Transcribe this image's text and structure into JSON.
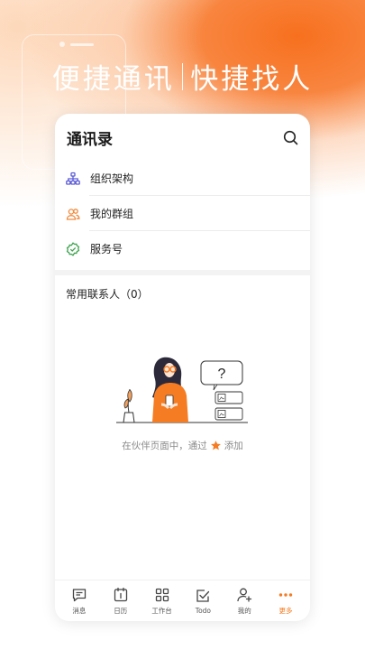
{
  "banner": {
    "left_text": "便捷通讯",
    "right_text": "快捷找人"
  },
  "contacts": {
    "title": "通讯录",
    "menu": [
      {
        "label": "组织架构",
        "icon": "org-chart-icon"
      },
      {
        "label": "我的群组",
        "icon": "group-icon"
      },
      {
        "label": "服务号",
        "icon": "verified-badge-icon"
      }
    ],
    "frequent_title": "常用联系人（0）",
    "empty_hint_before": "在伙伴页面中，通过",
    "empty_hint_after": "添加"
  },
  "tabs": [
    {
      "label": "消息",
      "icon": "message-icon",
      "active": false
    },
    {
      "label": "日历",
      "icon": "calendar-icon",
      "active": false
    },
    {
      "label": "工作台",
      "icon": "workbench-icon",
      "active": false
    },
    {
      "label": "Todo",
      "icon": "todo-icon",
      "active": false
    },
    {
      "label": "我的",
      "icon": "profile-icon",
      "active": false
    },
    {
      "label": "更多",
      "icon": "more-icon",
      "active": true
    }
  ],
  "colors": {
    "accent": "#f57c23",
    "org_icon": "#5b5bd6",
    "group_icon": "#f08a3c",
    "service_icon": "#3ea44f"
  }
}
